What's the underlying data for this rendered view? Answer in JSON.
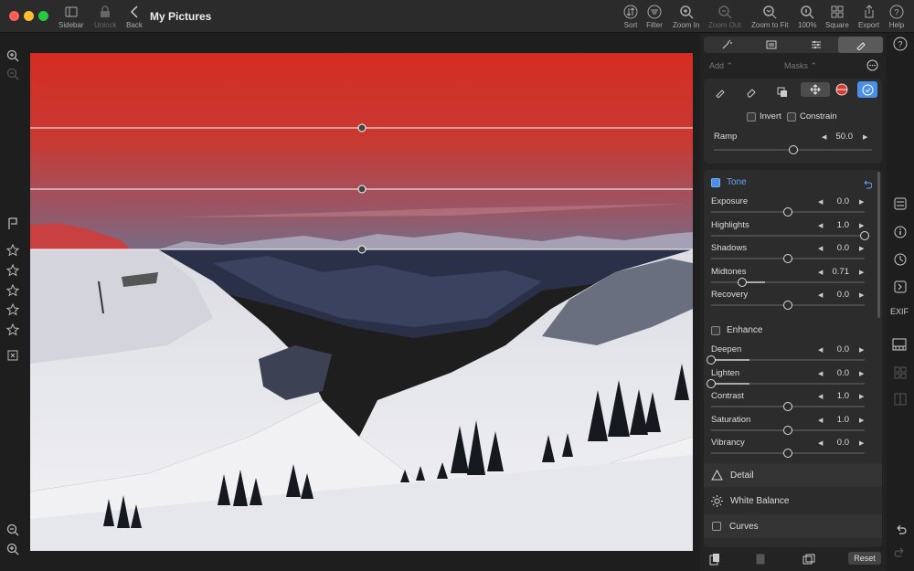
{
  "window": {
    "title": "My Pictures"
  },
  "toolbar_left": [
    {
      "label": "Sidebar",
      "icon": "sidebar-icon"
    },
    {
      "label": "Unlock",
      "icon": "lock-icon"
    },
    {
      "label": "Back",
      "icon": "chevron-left-icon"
    }
  ],
  "toolbar_right": [
    {
      "label": "Sort",
      "icon": "sort-icon"
    },
    {
      "label": "Filter",
      "icon": "filter-icon"
    },
    {
      "label": "Zoom In",
      "icon": "zoom-in-icon"
    },
    {
      "label": "Zoom Out",
      "icon": "zoom-out-icon"
    },
    {
      "label": "Zoom to Fit",
      "icon": "zoom-fit-icon"
    },
    {
      "label": "100%",
      "icon": "zoom-100-icon"
    },
    {
      "label": "Square",
      "icon": "square-grid-icon"
    },
    {
      "label": "Export",
      "icon": "share-icon"
    },
    {
      "label": "Help",
      "icon": "help-icon"
    }
  ],
  "panel": {
    "add_label": "Add ⌃",
    "masks_label": "Masks ⌃",
    "invert_label": "Invert",
    "constrain_label": "Constrain",
    "ramp": {
      "label": "Ramp",
      "value": "50.0",
      "level": 0.5
    },
    "tone": {
      "label": "Tone",
      "rows": [
        {
          "label": "Exposure",
          "value": "0.0",
          "level": 0.5
        },
        {
          "label": "Highlights",
          "value": "1.0",
          "level": 1.0
        },
        {
          "label": "Shadows",
          "value": "0.0",
          "level": 0.5
        },
        {
          "label": "Midtones",
          "value": "0.71",
          "level": 0.2
        },
        {
          "label": "Recovery",
          "value": "0.0",
          "level": 0.5
        }
      ]
    },
    "enhance": {
      "label": "Enhance",
      "rows": [
        {
          "label": "Deepen",
          "value": "0.0",
          "level": 0.0
        },
        {
          "label": "Lighten",
          "value": "0.0",
          "level": 0.0
        },
        {
          "label": "Contrast",
          "value": "1.0",
          "level": 0.5
        },
        {
          "label": "Saturation",
          "value": "1.0",
          "level": 0.5
        },
        {
          "label": "Vibrancy",
          "value": "0.0",
          "level": 0.5
        }
      ]
    },
    "sections": [
      "Detail",
      "White Balance",
      "Curves"
    ],
    "reset_label": "Reset"
  },
  "rightbar": {
    "exif_label": "EXIF"
  },
  "colors": {
    "accent": "#4a8fe8",
    "mask_red": "#d42c22"
  }
}
